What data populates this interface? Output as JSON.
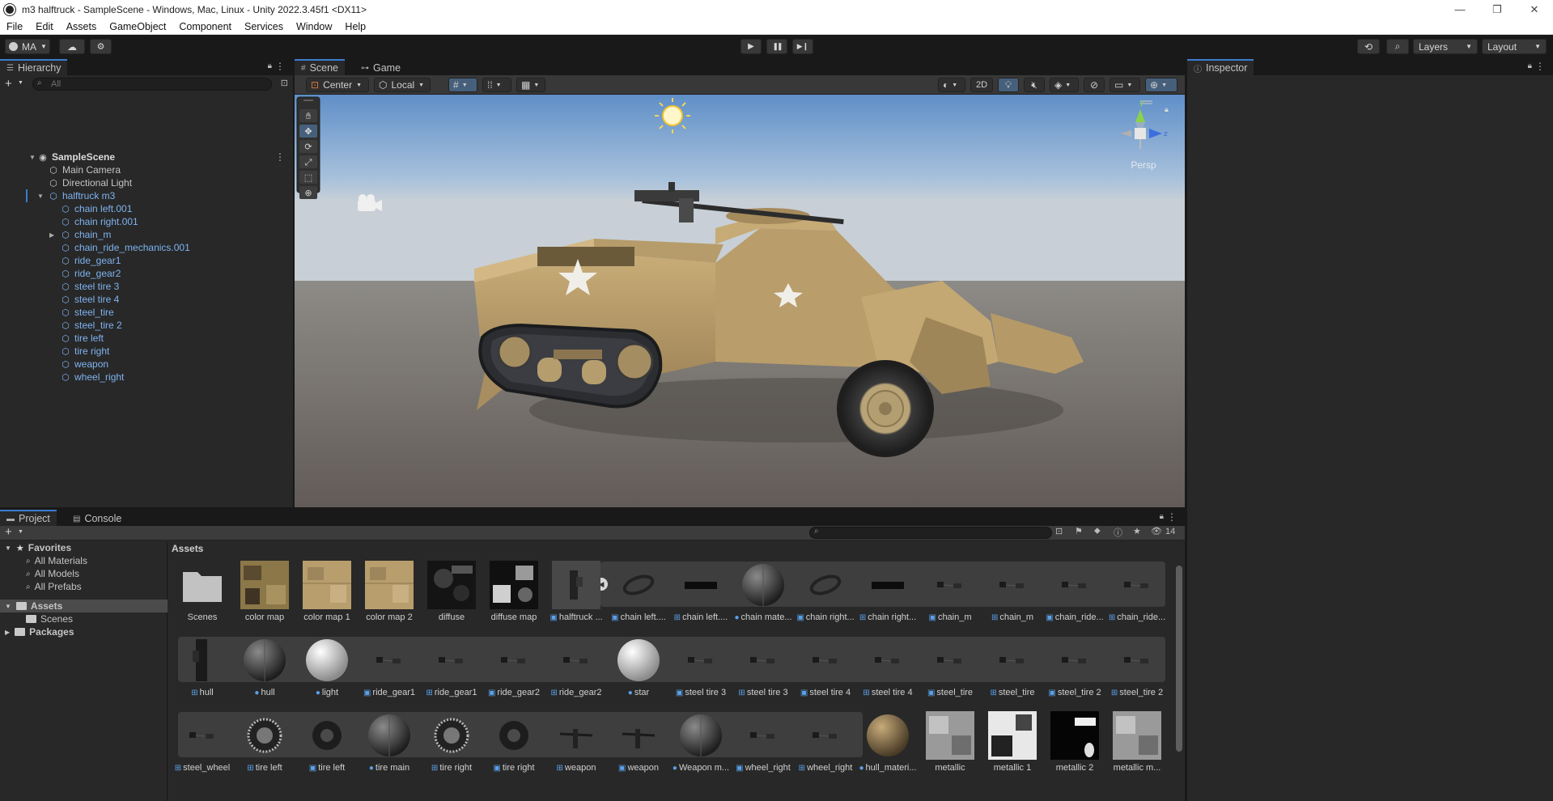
{
  "window": {
    "title": "m3 halftruck - SampleScene - Windows, Mac, Linux - Unity 2022.3.45f1 <DX11>",
    "controls": [
      "—",
      "❐",
      "✕"
    ]
  },
  "menu": [
    "File",
    "Edit",
    "Assets",
    "GameObject",
    "Component",
    "Services",
    "Window",
    "Help"
  ],
  "toolbar": {
    "account": "MA",
    "play": "▶",
    "pause": "❚❚",
    "step": "▶❙",
    "layers": "Layers",
    "layout": "Layout"
  },
  "hierarchy": {
    "tab": "Hierarchy",
    "search_placeholder": "All",
    "scene": "SampleScene",
    "items": [
      {
        "label": "Main Camera",
        "depth": 1,
        "blue": false
      },
      {
        "label": "Directional Light",
        "depth": 1,
        "blue": false
      },
      {
        "label": "halftruck m3",
        "depth": 1,
        "blue": true,
        "expanded": true
      },
      {
        "label": "chain left.001",
        "depth": 2,
        "blue": true
      },
      {
        "label": "chain right.001",
        "depth": 2,
        "blue": true
      },
      {
        "label": "chain_m",
        "depth": 2,
        "blue": true,
        "collapsed": true
      },
      {
        "label": "chain_ride_mechanics.001",
        "depth": 2,
        "blue": true
      },
      {
        "label": "ride_gear1",
        "depth": 2,
        "blue": true
      },
      {
        "label": "ride_gear2",
        "depth": 2,
        "blue": true
      },
      {
        "label": "steel tire 3",
        "depth": 2,
        "blue": true
      },
      {
        "label": "steel tire 4",
        "depth": 2,
        "blue": true
      },
      {
        "label": "steel_tire",
        "depth": 2,
        "blue": true
      },
      {
        "label": "steel_tire 2",
        "depth": 2,
        "blue": true
      },
      {
        "label": "tire left",
        "depth": 2,
        "blue": true
      },
      {
        "label": "tire right",
        "depth": 2,
        "blue": true
      },
      {
        "label": "weapon",
        "depth": 2,
        "blue": true
      },
      {
        "label": "wheel_right",
        "depth": 2,
        "blue": true
      }
    ]
  },
  "scene_view": {
    "tabs": [
      "Scene",
      "Game"
    ],
    "pivot": "Center",
    "space": "Local",
    "mode_2d": "2D",
    "projection": "Persp",
    "gizmo_y": "y",
    "gizmo_z": "z"
  },
  "inspector": {
    "tab": "Inspector"
  },
  "project": {
    "tabs": [
      "Project",
      "Console"
    ],
    "hidden_count": "14",
    "favorites_header": "Favorites",
    "favorites": [
      "All Materials",
      "All Models",
      "All Prefabs"
    ],
    "assets_root": "Assets",
    "assets_children": [
      "Scenes"
    ],
    "packages": "Packages",
    "breadcrumb": "Assets",
    "rows": [
      [
        {
          "label": "Scenes",
          "kind": "folder"
        },
        {
          "label": "color map",
          "kind": "tex-yellow"
        },
        {
          "label": "color map 1",
          "kind": "tex-tan"
        },
        {
          "label": "color map 2",
          "kind": "tex-tan"
        },
        {
          "label": "diffuse",
          "kind": "tex-dark"
        },
        {
          "label": "diffuse map",
          "kind": "tex-dark2"
        },
        {
          "label": "halftruck ...",
          "kind": "model",
          "mini": "▣"
        },
        {
          "label": "chain left....",
          "kind": "chain",
          "mini": "▣"
        },
        {
          "label": "chain left....",
          "kind": "bar",
          "mini": "⊞"
        },
        {
          "label": "chain mate...",
          "kind": "sphere-dark",
          "mini": "●"
        },
        {
          "label": "chain right...",
          "kind": "chain",
          "mini": "▣"
        },
        {
          "label": "chain right...",
          "kind": "bar",
          "mini": "⊞"
        },
        {
          "label": "chain_m",
          "kind": "small",
          "mini": "▣"
        },
        {
          "label": "chain_m",
          "kind": "small",
          "mini": "⊞"
        },
        {
          "label": "chain_ride...",
          "kind": "small",
          "mini": "▣"
        },
        {
          "label": "chain_ride...",
          "kind": "small",
          "mini": "⊞"
        }
      ],
      [
        {
          "label": "hull",
          "kind": "hull",
          "mini": "⊞"
        },
        {
          "label": "hull",
          "kind": "sphere-dark",
          "mini": "●"
        },
        {
          "label": "light",
          "kind": "sphere-light",
          "mini": "●"
        },
        {
          "label": "ride_gear1",
          "kind": "small",
          "mini": "▣"
        },
        {
          "label": "ride_gear1",
          "kind": "small",
          "mini": "⊞"
        },
        {
          "label": "ride_gear2",
          "kind": "small",
          "mini": "▣"
        },
        {
          "label": "ride_gear2",
          "kind": "small",
          "mini": "⊞"
        },
        {
          "label": "star",
          "kind": "sphere-light",
          "mini": "●"
        },
        {
          "label": "steel tire 3",
          "kind": "small",
          "mini": "▣"
        },
        {
          "label": "steel tire 3",
          "kind": "small",
          "mini": "⊞"
        },
        {
          "label": "steel tire 4",
          "kind": "small",
          "mini": "▣"
        },
        {
          "label": "steel tire 4",
          "kind": "small",
          "mini": "⊞"
        },
        {
          "label": "steel_tire",
          "kind": "small",
          "mini": "▣"
        },
        {
          "label": "steel_tire",
          "kind": "small",
          "mini": "⊞"
        },
        {
          "label": "steel_tire 2",
          "kind": "small",
          "mini": "▣"
        },
        {
          "label": "steel_tire 2",
          "kind": "small",
          "mini": "⊞"
        }
      ],
      [
        {
          "label": "steel_wheel",
          "kind": "small",
          "mini": "⊞"
        },
        {
          "label": "tire left",
          "kind": "tire",
          "mini": "⊞"
        },
        {
          "label": "tire left",
          "kind": "tire-dark",
          "mini": "▣"
        },
        {
          "label": "tire main",
          "kind": "sphere-dark",
          "mini": "●"
        },
        {
          "label": "tire right",
          "kind": "tire",
          "mini": "⊞"
        },
        {
          "label": "tire right",
          "kind": "tire-dark",
          "mini": "▣"
        },
        {
          "label": "weapon",
          "kind": "gun",
          "mini": "⊞"
        },
        {
          "label": "weapon",
          "kind": "gun",
          "mini": "▣"
        },
        {
          "label": "Weapon m...",
          "kind": "sphere-dark",
          "mini": "●"
        },
        {
          "label": "wheel_right",
          "kind": "small",
          "mini": "▣"
        },
        {
          "label": "wheel_right",
          "kind": "small",
          "mini": "⊞"
        },
        {
          "label": "hull_materi...",
          "kind": "sphere-brown",
          "mini": "●"
        },
        {
          "label": "metallic",
          "kind": "tex-grey"
        },
        {
          "label": "metallic 1",
          "kind": "tex-bw"
        },
        {
          "label": "metallic 2",
          "kind": "tex-black"
        },
        {
          "label": "metallic m...",
          "kind": "tex-grey"
        }
      ]
    ]
  }
}
